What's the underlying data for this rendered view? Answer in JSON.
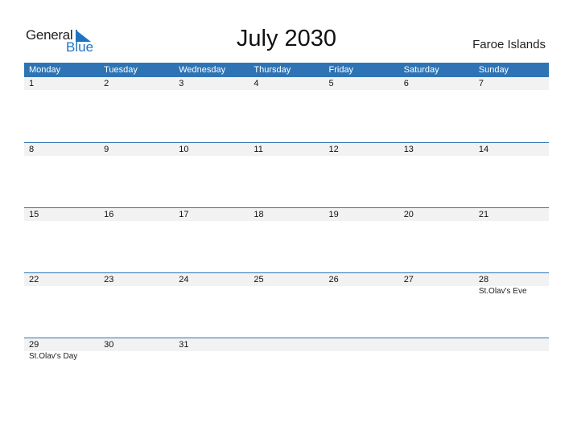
{
  "logo": {
    "general": "General",
    "blue": "Blue"
  },
  "title": "July 2030",
  "country": "Faroe Islands",
  "colors": {
    "header": "#2e74b5",
    "strip": "#f2f2f2",
    "logo_blue": "#1f74bf"
  },
  "weekdays": [
    "Monday",
    "Tuesday",
    "Wednesday",
    "Thursday",
    "Friday",
    "Saturday",
    "Sunday"
  ],
  "weeks": [
    [
      {
        "day": "1"
      },
      {
        "day": "2"
      },
      {
        "day": "3"
      },
      {
        "day": "4"
      },
      {
        "day": "5"
      },
      {
        "day": "6"
      },
      {
        "day": "7"
      }
    ],
    [
      {
        "day": "8"
      },
      {
        "day": "9"
      },
      {
        "day": "10"
      },
      {
        "day": "11"
      },
      {
        "day": "12"
      },
      {
        "day": "13"
      },
      {
        "day": "14"
      }
    ],
    [
      {
        "day": "15"
      },
      {
        "day": "16"
      },
      {
        "day": "17"
      },
      {
        "day": "18"
      },
      {
        "day": "19"
      },
      {
        "day": "20"
      },
      {
        "day": "21"
      }
    ],
    [
      {
        "day": "22"
      },
      {
        "day": "23"
      },
      {
        "day": "24"
      },
      {
        "day": "25"
      },
      {
        "day": "26"
      },
      {
        "day": "27"
      },
      {
        "day": "28",
        "holiday": "St.Olav's Eve"
      }
    ],
    [
      {
        "day": "29",
        "holiday": "St.Olav's Day"
      },
      {
        "day": "30"
      },
      {
        "day": "31"
      },
      {
        "day": ""
      },
      {
        "day": ""
      },
      {
        "day": ""
      },
      {
        "day": ""
      }
    ]
  ]
}
